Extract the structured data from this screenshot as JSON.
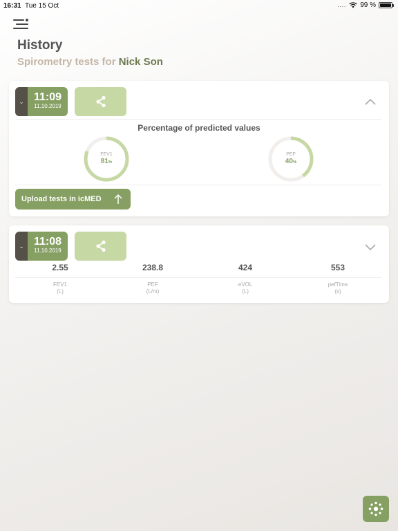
{
  "status_bar": {
    "time": "16:31",
    "date": "Tue 15 Oct",
    "signal": "....",
    "battery": "99 %"
  },
  "header": {
    "title": "History",
    "subtitle_prefix": "Spirometry tests for ",
    "patient_name": "Nick Son"
  },
  "tests": [
    {
      "time": "11:09",
      "date": "11.10.2019",
      "expanded": true,
      "predicted_title": "Percentage of predicted values",
      "gauges": [
        {
          "label": "FEV1",
          "value": "81",
          "unit": "%",
          "fraction": 0.81
        },
        {
          "label": "PEF",
          "value": "40",
          "unit": "%",
          "fraction": 0.4
        }
      ],
      "upload_label": "Upload tests in icMED"
    },
    {
      "time": "11:08",
      "date": "11.10.2019",
      "expanded": false,
      "metrics": [
        {
          "value": "2.55",
          "name": "FEV1",
          "unit": "(L)"
        },
        {
          "value": "238.8",
          "name": "PEF",
          "unit": "(L/m)"
        },
        {
          "value": "424",
          "name": "eVOL",
          "unit": "(L)"
        },
        {
          "value": "553",
          "name": "pefTime",
          "unit": "(s)"
        }
      ]
    }
  ],
  "colors": {
    "accent": "#86a063",
    "accent_light": "#c6d8a4",
    "dark": "#555048",
    "name": "#6e7a4f"
  },
  "icons": {
    "menu": "menu-icon",
    "share": "share-icon",
    "upload": "arrow-up-icon",
    "fab": "settings-icon"
  }
}
